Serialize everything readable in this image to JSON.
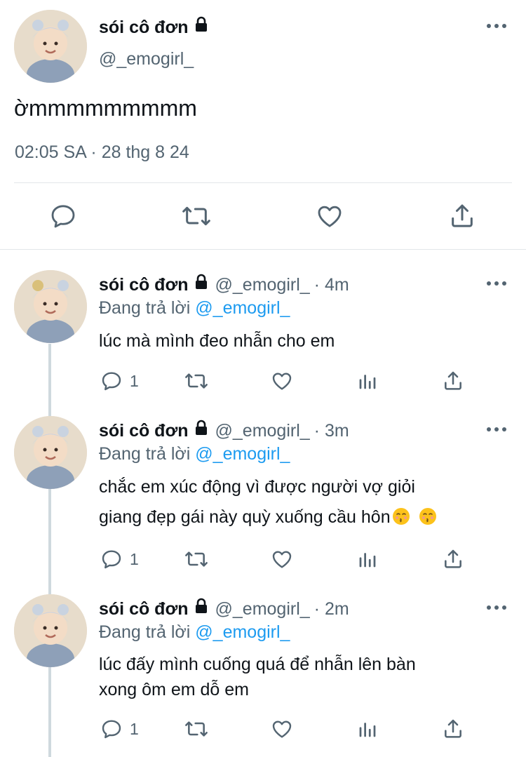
{
  "main_tweet": {
    "author": {
      "name": "sói cô đơn",
      "handle": "@_emogirl_"
    },
    "text": "ờmmmmmmmmm",
    "timestamp": "02:05 SA · 28 thg 8 24",
    "actions": [
      "reply-icon",
      "retweet-icon",
      "like-icon",
      "share-icon"
    ]
  },
  "replies": [
    {
      "name": "sói cô đơn",
      "handle": "@_emogirl_",
      "time": "· 4m",
      "replying_prefix": "Đang trả lời",
      "replying_to": "@_emogirl_",
      "text": "lúc mà mình đeo nhẫn cho em",
      "reply_count": "1"
    },
    {
      "name": "sói cô đơn",
      "handle": "@_emogirl_",
      "time": "· 3m",
      "replying_prefix": "Đang trả lời",
      "replying_to": "@_emogirl_",
      "text_line1": "chắc em xúc động vì được người vợ giỏi",
      "text_line2": "giang đẹp gái này quỳ xuống cầu hôn",
      "text_emojis": [
        "kissing-face-emoji",
        "kissing-face-emoji"
      ],
      "reply_count": "1"
    },
    {
      "name": "sói cô đơn",
      "handle": "@_emogirl_",
      "time": "· 2m",
      "replying_prefix": "Đang trả lời",
      "replying_to": "@_emogirl_",
      "text_line1": "lúc đấy mình cuống quá để nhẫn lên bàn",
      "text_line2": "xong ôm em dỗ em",
      "reply_count": "1"
    }
  ],
  "colors": {
    "accent": "#1d9bf0",
    "muted": "#536471",
    "text": "#0f1419",
    "divider": "#e2e6e9"
  }
}
